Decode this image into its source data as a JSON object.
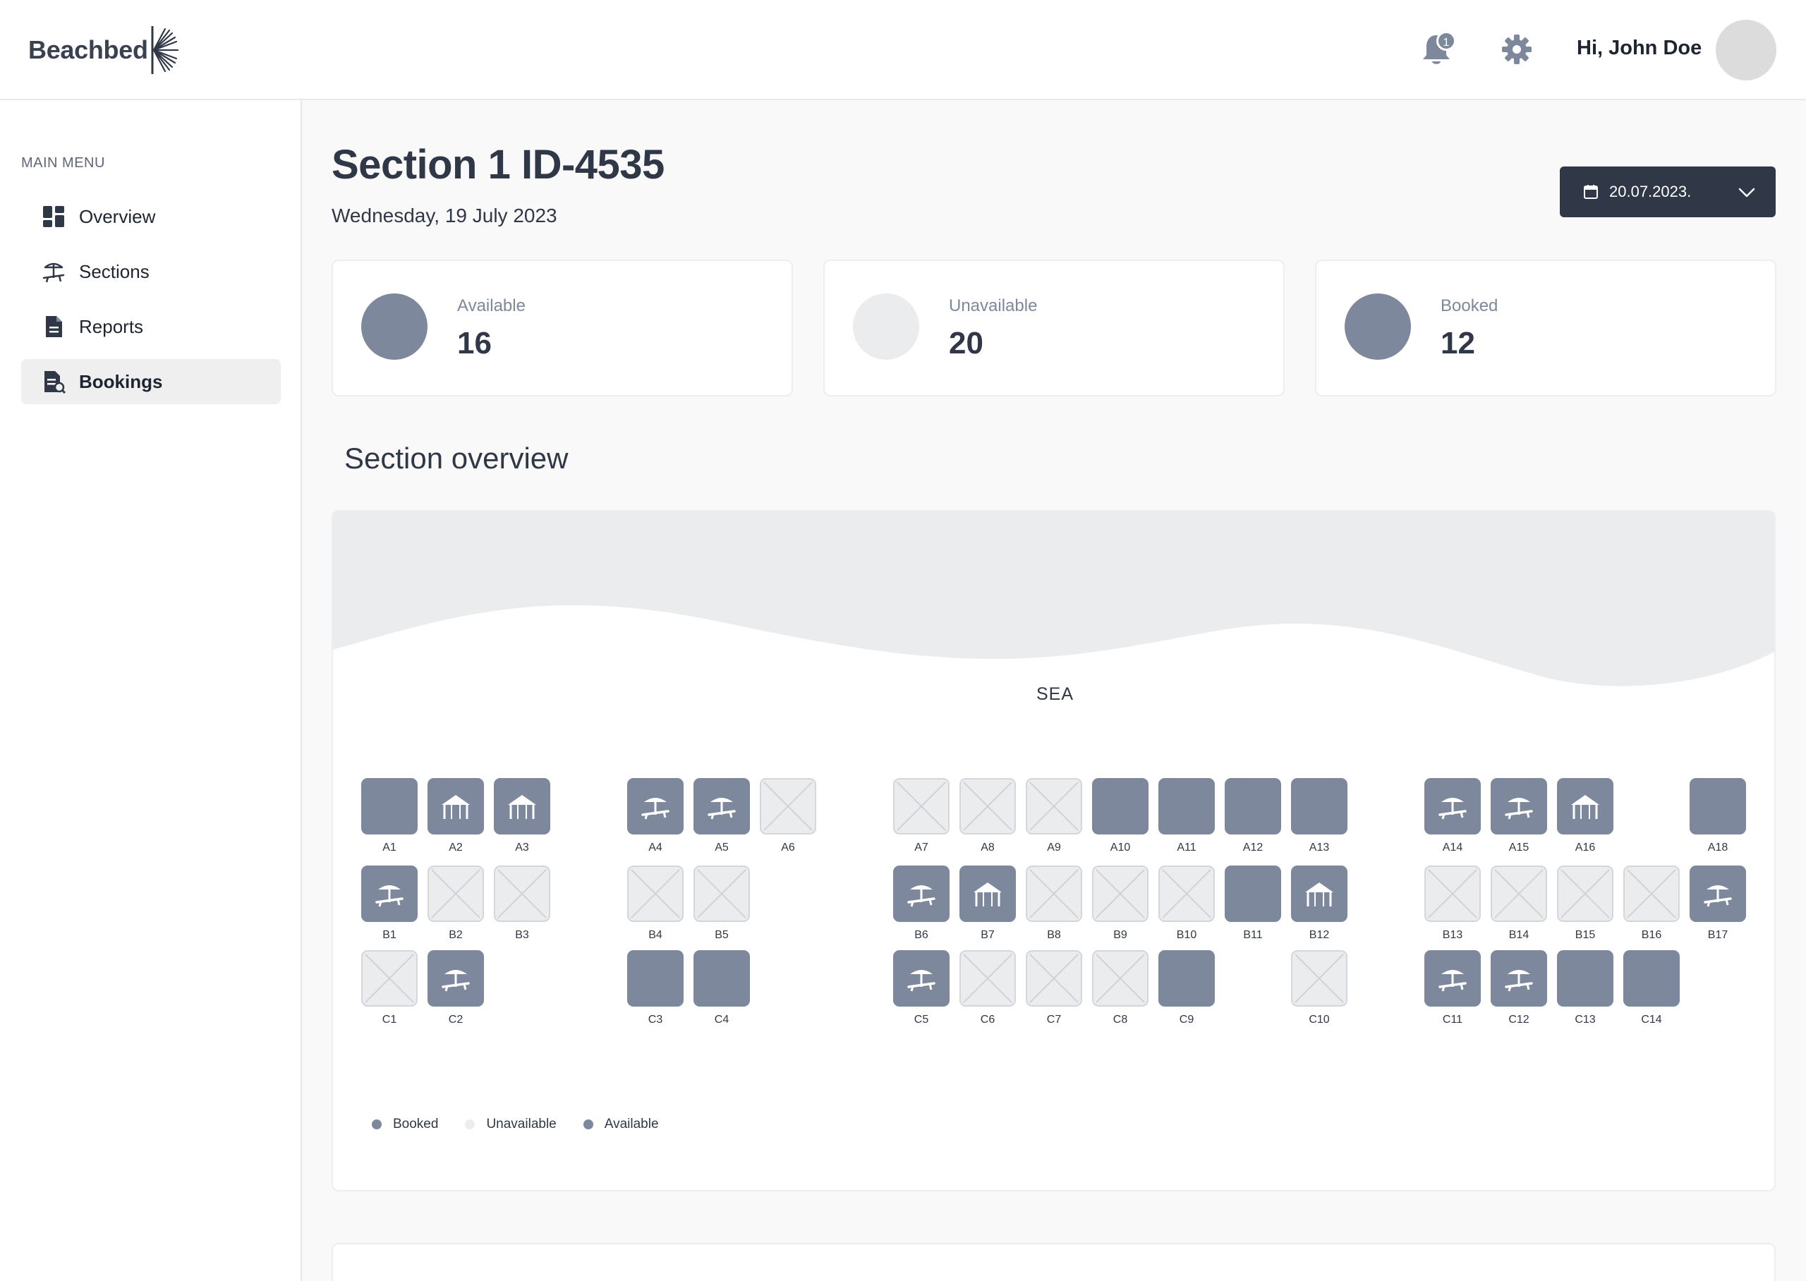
{
  "header": {
    "logo_text": "Beachbed",
    "notification_count": "1",
    "greeting": "Hi, John Doe"
  },
  "sidebar": {
    "menu_title": "MAIN MENU",
    "items": [
      {
        "label": "Overview",
        "icon": "dashboard-icon",
        "active": false
      },
      {
        "label": "Sections",
        "icon": "sunbed-umbrella-icon",
        "active": false
      },
      {
        "label": "Reports",
        "icon": "document-icon",
        "active": false
      },
      {
        "label": "Bookings",
        "icon": "bookings-document-icon",
        "active": true
      }
    ]
  },
  "page": {
    "title": "Section 1 ID-4535",
    "date": "Wednesday, 19 July 2023",
    "date_picker_value": "20.07.2023."
  },
  "stats": [
    {
      "label": "Available",
      "value": "16",
      "color": "#7d889c"
    },
    {
      "label": "Unavailable",
      "value": "20",
      "color": "#ebecee"
    },
    {
      "label": "Booked",
      "value": "12",
      "color": "#7d889c"
    }
  ],
  "overview": {
    "heading": "Section overview",
    "sea_label": "SEA",
    "legend": [
      {
        "label": "Booked",
        "color": "#7d889c"
      },
      {
        "label": "Unavailable",
        "color": "#ebecee"
      },
      {
        "label": "Available",
        "color": "#7d889c"
      }
    ],
    "seats": [
      {
        "id": "A1",
        "status": "booked",
        "icon": "none"
      },
      {
        "id": "A2",
        "status": "available",
        "icon": "tent"
      },
      {
        "id": "A3",
        "status": "available",
        "icon": "tent"
      },
      {
        "id": "A4",
        "status": "available",
        "icon": "sunbed"
      },
      {
        "id": "A5",
        "status": "available",
        "icon": "sunbed"
      },
      {
        "id": "A6",
        "status": "unavailable",
        "icon": "cross"
      },
      {
        "id": "A7",
        "status": "unavailable",
        "icon": "cross"
      },
      {
        "id": "A8",
        "status": "unavailable",
        "icon": "cross"
      },
      {
        "id": "A9",
        "status": "unavailable",
        "icon": "cross"
      },
      {
        "id": "A10",
        "status": "booked",
        "icon": "none"
      },
      {
        "id": "A11",
        "status": "booked",
        "icon": "none"
      },
      {
        "id": "A12",
        "status": "booked",
        "icon": "none"
      },
      {
        "id": "A13",
        "status": "booked",
        "icon": "none"
      },
      {
        "id": "A14",
        "status": "available",
        "icon": "sunbed"
      },
      {
        "id": "A15",
        "status": "available",
        "icon": "sunbed"
      },
      {
        "id": "A16",
        "status": "available",
        "icon": "tent"
      },
      {
        "id": "A18",
        "status": "booked",
        "icon": "none"
      },
      {
        "id": "B1",
        "status": "available",
        "icon": "sunbed"
      },
      {
        "id": "B2",
        "status": "unavailable",
        "icon": "cross"
      },
      {
        "id": "B3",
        "status": "unavailable",
        "icon": "cross"
      },
      {
        "id": "B4",
        "status": "unavailable",
        "icon": "cross"
      },
      {
        "id": "B5",
        "status": "unavailable",
        "icon": "cross"
      },
      {
        "id": "B6",
        "status": "available",
        "icon": "sunbed"
      },
      {
        "id": "B7",
        "status": "available",
        "icon": "tent"
      },
      {
        "id": "B8",
        "status": "unavailable",
        "icon": "cross"
      },
      {
        "id": "B9",
        "status": "unavailable",
        "icon": "cross"
      },
      {
        "id": "B10",
        "status": "unavailable",
        "icon": "cross"
      },
      {
        "id": "B11",
        "status": "booked",
        "icon": "none"
      },
      {
        "id": "B12",
        "status": "available",
        "icon": "tent"
      },
      {
        "id": "B13",
        "status": "unavailable",
        "icon": "cross"
      },
      {
        "id": "B14",
        "status": "unavailable",
        "icon": "cross"
      },
      {
        "id": "B15",
        "status": "unavailable",
        "icon": "cross"
      },
      {
        "id": "B16",
        "status": "unavailable",
        "icon": "cross"
      },
      {
        "id": "B17",
        "status": "available",
        "icon": "sunbed"
      },
      {
        "id": "C1",
        "status": "unavailable",
        "icon": "cross"
      },
      {
        "id": "C2",
        "status": "available",
        "icon": "sunbed"
      },
      {
        "id": "C3",
        "status": "booked",
        "icon": "none"
      },
      {
        "id": "C4",
        "status": "booked",
        "icon": "none"
      },
      {
        "id": "C5",
        "status": "available",
        "icon": "sunbed"
      },
      {
        "id": "C6",
        "status": "unavailable",
        "icon": "cross"
      },
      {
        "id": "C7",
        "status": "unavailable",
        "icon": "cross"
      },
      {
        "id": "C8",
        "status": "unavailable",
        "icon": "cross"
      },
      {
        "id": "C9",
        "status": "booked",
        "icon": "none"
      },
      {
        "id": "C10",
        "status": "unavailable",
        "icon": "cross"
      },
      {
        "id": "C11",
        "status": "available",
        "icon": "sunbed"
      },
      {
        "id": "C12",
        "status": "available",
        "icon": "sunbed"
      },
      {
        "id": "C13",
        "status": "booked",
        "icon": "none"
      },
      {
        "id": "C14",
        "status": "booked",
        "icon": "none"
      }
    ]
  },
  "colors": {
    "accent": "#303847",
    "booked": "#7d889c",
    "unavailable": "#ebecee"
  }
}
